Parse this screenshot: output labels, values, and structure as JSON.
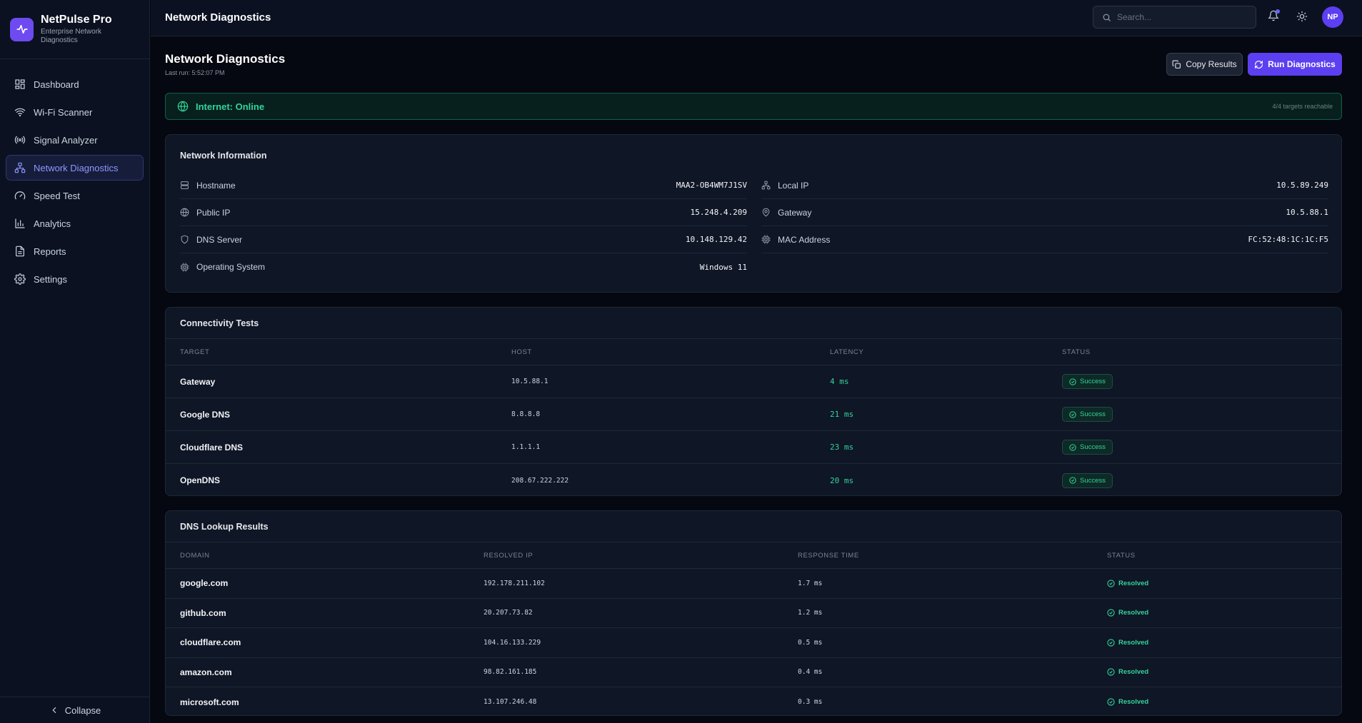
{
  "brand": {
    "name": "NetPulse Pro",
    "subtitle": "Enterprise Network Diagnostics"
  },
  "sidebar": {
    "items": [
      {
        "label": "Dashboard",
        "icon": "dashboard-icon"
      },
      {
        "label": "Wi-Fi Scanner",
        "icon": "wifi-icon"
      },
      {
        "label": "Signal Analyzer",
        "icon": "signal-icon"
      },
      {
        "label": "Network Diagnostics",
        "icon": "network-icon",
        "active": true
      },
      {
        "label": "Speed Test",
        "icon": "gauge-icon"
      },
      {
        "label": "Analytics",
        "icon": "bar-chart-icon"
      },
      {
        "label": "Reports",
        "icon": "file-icon"
      },
      {
        "label": "Settings",
        "icon": "gear-icon"
      }
    ],
    "collapse_label": "Collapse"
  },
  "topbar": {
    "title": "Network Diagnostics",
    "search_placeholder": "Search...",
    "avatar_initials": "NP"
  },
  "page": {
    "title": "Network Diagnostics",
    "last_run": "Last run: 5:52:07 PM",
    "copy_label": "Copy Results",
    "run_label": "Run Diagnostics"
  },
  "status": {
    "text": "Internet: Online",
    "reachable": "4/4 targets reachable",
    "color": "#34d399"
  },
  "network_info": {
    "title": "Network Information",
    "left": [
      {
        "label": "Hostname",
        "value": "MAA2-OB4WM7J1SV",
        "icon": "server-icon"
      },
      {
        "label": "Public IP",
        "value": "15.248.4.209",
        "icon": "globe-icon"
      },
      {
        "label": "DNS Server",
        "value": "10.148.129.42",
        "icon": "shield-icon"
      },
      {
        "label": "Operating System",
        "value": "Windows 11",
        "icon": "cpu-icon"
      }
    ],
    "right": [
      {
        "label": "Local IP",
        "value": "10.5.89.249",
        "icon": "network-icon"
      },
      {
        "label": "Gateway",
        "value": "10.5.88.1",
        "icon": "pin-icon"
      },
      {
        "label": "MAC Address",
        "value": "FC:52:48:1C:1C:F5",
        "icon": "chip-icon"
      }
    ]
  },
  "connectivity": {
    "title": "Connectivity Tests",
    "headers": [
      "TARGET",
      "HOST",
      "LATENCY",
      "STATUS"
    ],
    "rows": [
      {
        "target": "Gateway",
        "host": "10.5.88.1",
        "latency": "4 ms",
        "status": "Success"
      },
      {
        "target": "Google DNS",
        "host": "8.8.8.8",
        "latency": "21 ms",
        "status": "Success"
      },
      {
        "target": "Cloudflare DNS",
        "host": "1.1.1.1",
        "latency": "23 ms",
        "status": "Success"
      },
      {
        "target": "OpenDNS",
        "host": "208.67.222.222",
        "latency": "20 ms",
        "status": "Success"
      }
    ]
  },
  "dns": {
    "title": "DNS Lookup Results",
    "headers": [
      "DOMAIN",
      "RESOLVED IP",
      "RESPONSE TIME",
      "STATUS"
    ],
    "rows": [
      {
        "domain": "google.com",
        "ip": "192.178.211.102",
        "time": "1.7 ms",
        "status": "Resolved"
      },
      {
        "domain": "github.com",
        "ip": "20.207.73.82",
        "time": "1.2 ms",
        "status": "Resolved"
      },
      {
        "domain": "cloudflare.com",
        "ip": "104.16.133.229",
        "time": "0.5 ms",
        "status": "Resolved"
      },
      {
        "domain": "amazon.com",
        "ip": "98.82.161.185",
        "time": "0.4 ms",
        "status": "Resolved"
      },
      {
        "domain": "microsoft.com",
        "ip": "13.107.246.48",
        "time": "0.3 ms",
        "status": "Resolved"
      }
    ]
  }
}
